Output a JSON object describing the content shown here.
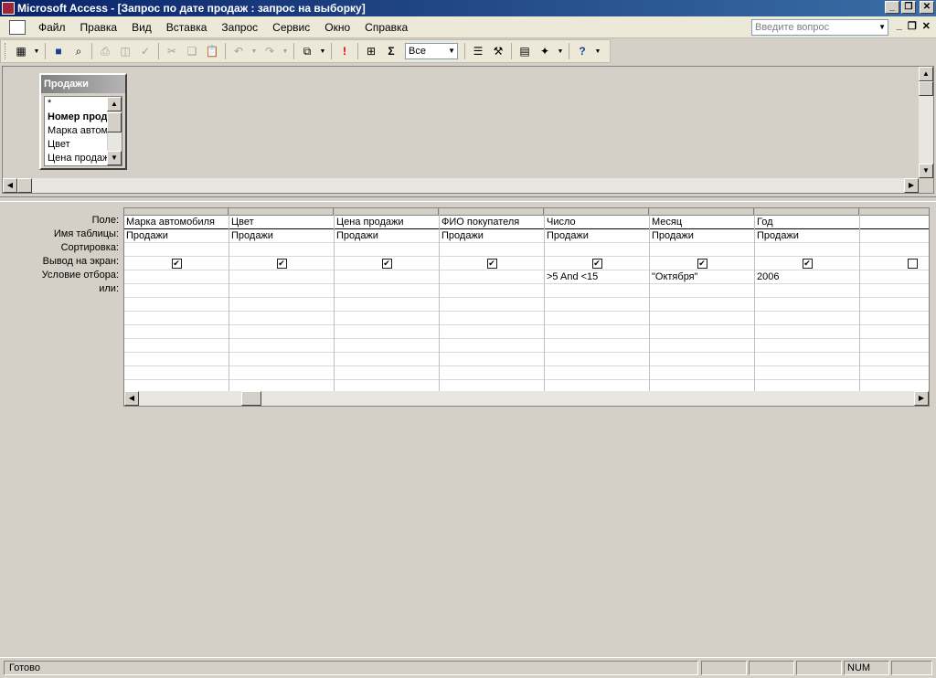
{
  "window": {
    "title": "Microsoft Access - [Запрос по дате продаж : запрос на выборку]"
  },
  "menu": {
    "items": [
      "Файл",
      "Правка",
      "Вид",
      "Вставка",
      "Запрос",
      "Сервис",
      "Окно",
      "Справка"
    ],
    "ask_placeholder": "Введите вопрос"
  },
  "toolbar": {
    "top_values_select": "Все"
  },
  "table_box": {
    "title": "Продажи",
    "fields": [
      "*",
      "Номер прода",
      "Марка автом",
      "Цвет",
      "Цена продаж"
    ]
  },
  "grid": {
    "row_labels": [
      "Поле:",
      "Имя таблицы:",
      "Сортировка:",
      "Вывод на экран:",
      "Условие отбора:",
      "или:"
    ],
    "columns": [
      {
        "field": "Марка автомобиля",
        "table": "Продажи",
        "sort": "",
        "show": true,
        "criteria": ""
      },
      {
        "field": "Цвет",
        "table": "Продажи",
        "sort": "",
        "show": true,
        "criteria": ""
      },
      {
        "field": "Цена продажи",
        "table": "Продажи",
        "sort": "",
        "show": true,
        "criteria": ""
      },
      {
        "field": "ФИО покупателя",
        "table": "Продажи",
        "sort": "",
        "show": true,
        "criteria": ""
      },
      {
        "field": "Число",
        "table": "Продажи",
        "sort": "",
        "show": true,
        "criteria": ">5 And <15"
      },
      {
        "field": "Месяц",
        "table": "Продажи",
        "sort": "",
        "show": true,
        "criteria": "\"Октября\""
      },
      {
        "field": "Год",
        "table": "Продажи",
        "sort": "",
        "show": true,
        "criteria": "2006"
      },
      {
        "field": "",
        "table": "",
        "sort": "",
        "show": false,
        "criteria": ""
      }
    ]
  },
  "status": {
    "text": "Готово",
    "num": "NUM"
  }
}
